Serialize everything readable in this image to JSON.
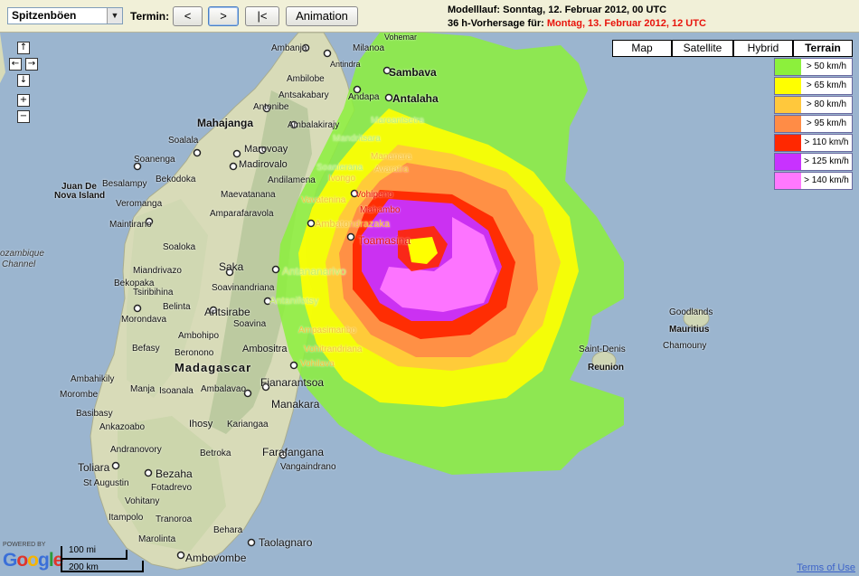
{
  "toolbar": {
    "parameter_select": "Spitzenböen",
    "termin_label": "Termin:",
    "btn_prev": "<",
    "btn_next": ">",
    "btn_first": "|<",
    "btn_animation": "Animation",
    "model_run_label": "Modelllauf:",
    "model_run_value": "Sonntag, 12. Februar 2012, 00 UTC",
    "forecast_label": "36 h-Vorhersage für:",
    "forecast_value": "Montag, 13. Februar 2012, 12 UTC"
  },
  "map_controls": {
    "pan_up": "↑",
    "pan_left": "←",
    "pan_right": "→",
    "pan_down": "↓",
    "zoom_in": "+",
    "zoom_out": "−"
  },
  "map_types": [
    "Map",
    "Satellite",
    "Hybrid",
    "Terrain"
  ],
  "map_type_active": "Terrain",
  "legend": [
    {
      "label": "> 50 km/h",
      "color": "#8cf03c"
    },
    {
      "label": "> 65 km/h",
      "color": "#ffff00"
    },
    {
      "label": "> 80 km/h",
      "color": "#ffc83c"
    },
    {
      "label": "> 95 km/h",
      "color": "#ff8c46"
    },
    {
      "label": "> 110 km/h",
      "color": "#ff2800"
    },
    {
      "label": "> 125 km/h",
      "color": "#c832ff"
    },
    {
      "label": "> 140 km/h",
      "color": "#ff78ff"
    }
  ],
  "places": {
    "ambanja": "Ambanja",
    "milanoa": "Milanoa",
    "vohemar": "Vohemar",
    "sambava": "Sambava",
    "antindra": "Antindra",
    "ambilobe": "Ambilobe",
    "antsakabary": "Antsakabary",
    "andapa": "Andapa",
    "antalaha": "Antalaha",
    "antonibe": "Antonibe",
    "ambalakirajy": "Ambalakirajy",
    "maroantsetra": "Maroantsetra",
    "mahajanga": "Mahajanga",
    "soalala": "Soalala",
    "marovoay": "Marovoay",
    "mandritsara": "Mandritsara",
    "soanenga": "Soanenga",
    "madirovalo": "Madirovalo",
    "mananara": "Mananara",
    "avaratra": "Avaratra",
    "soanierana": "Soanierana",
    "ivongo": "Ivongo",
    "besalampy": "Besalampy",
    "bekodoka": "Bekodoka",
    "andilamena": "Andilamena",
    "juan": "Juan De",
    "novaisland": "Nova Island",
    "maevatanana": "Maevatanana",
    "vavatenina": "Vavatenina",
    "vohipeno": "Vohipeno",
    "veromanga": "Veromanga",
    "mahambo": "Mahambo",
    "amparafaravola": "Amparafaravola",
    "maintirano": "Maintirano",
    "ambatondrazaka": "Ambatondrazaka",
    "toamasina": "Toamasina",
    "mozambique": "ozambique",
    "channel": "Channel",
    "soaloka": "Soaloka",
    "miandrivazo": "Miandrivazo",
    "saka": "Saka",
    "antananarivo": "Antananarivo",
    "bekopaka": "Bekopaka",
    "soavinandriana": "Soavinandriana",
    "tsiribihina": "Tsiribihina",
    "antanifotsy": "Antanifotsy",
    "belinta": "Belinta",
    "antsirabe": "Antsirabe",
    "morondava": "Morondava",
    "soavina": "Soavina",
    "ampasimanbo": "Ampasimanbo",
    "befasy": "Befasy",
    "ambositra": "Ambositra",
    "vohitrandriana": "Vohitrandriana",
    "beronono": "Beronono",
    "ambohipo": "Ambohipo",
    "vohilava": "Vohilava",
    "madagascar": "Madagascar",
    "ambahikily": "Ambahikily",
    "manja": "Manja",
    "isoanala": "Isoanala",
    "ambalavao": "Ambalavao",
    "fianarantsoa": "Fianarantsoa",
    "morombe": "Morombe",
    "ankazoabo": "Ankazoabo",
    "basibasy": "Basibasy",
    "ihosy": "Ihosy",
    "kariangaa": "Kariangaa",
    "manakara": "Manakara",
    "andranovory": "Andranovory",
    "betroka": "Betroka",
    "farafangana": "Farafangana",
    "toliara": "Toliara",
    "bezaha": "Bezaha",
    "vangaindrano": "Vangaindrano",
    "staugustin": "St Augustin",
    "fotadrevo": "Fotadrevo",
    "vohitany": "Vohitany",
    "itampolo": "Itampolo",
    "tranoroa": "Tranoroa",
    "behara": "Behara",
    "marolinta": "Marolinta",
    "taolagnaro": "Taolagnaro",
    "ambovombe": "Ambovombe",
    "goodlands": "Goodlands",
    "mauritius": "Mauritius",
    "chamouny": "Chamouny",
    "saintdenis": "Saint-Denis",
    "reunion": "Reunion"
  },
  "attribution": {
    "powered_by": "POWERED BY",
    "google": "Google",
    "scale_mi": "100 mi",
    "scale_km": "200 km",
    "terms": "Terms of Use"
  }
}
